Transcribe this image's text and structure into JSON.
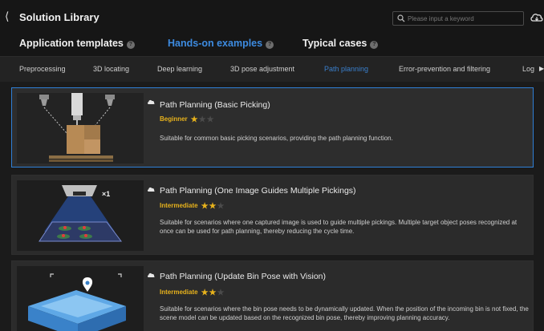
{
  "header": {
    "title": "Solution Library",
    "search_placeholder": "Please input a keyword"
  },
  "category_tabs": [
    {
      "label": "Application templates",
      "active": false
    },
    {
      "label": "Hands-on examples",
      "active": true
    },
    {
      "label": "Typical cases",
      "active": false
    }
  ],
  "sub_tabs": [
    {
      "label": "Preprocessing",
      "active": false
    },
    {
      "label": "3D locating",
      "active": false
    },
    {
      "label": "Deep learning",
      "active": false
    },
    {
      "label": "3D pose adjustment",
      "active": false
    },
    {
      "label": "Path planning",
      "active": true
    },
    {
      "label": "Error-prevention and filtering",
      "active": false
    },
    {
      "label": "Log",
      "active": false
    }
  ],
  "cards": [
    {
      "title": "Path Planning (Basic Picking)",
      "level": "Beginner",
      "stars": 1,
      "max_stars": 3,
      "description": "Suitable for common basic picking scenarios, providing the path planning function.",
      "selected": true
    },
    {
      "title": "Path Planning (One Image Guides Multiple Pickings)",
      "level": "Intermediate",
      "stars": 2,
      "max_stars": 3,
      "description": "Suitable for scenarios where one captured image is used to guide multiple pickings. Multiple target object poses recognized at once can be used for path planning, thereby reducing the cycle time.",
      "selected": false,
      "thumb_badge": "×1"
    },
    {
      "title": "Path Planning (Update Bin Pose with Vision)",
      "level": "Intermediate",
      "stars": 2,
      "max_stars": 3,
      "description": "Suitable for scenarios where the bin pose needs to be dynamically updated. When the position of the incoming bin is not fixed, the scene model can be updated based on the recognized bin pose, thereby improving planning accuracy.",
      "selected": false
    }
  ],
  "colors": {
    "accent": "#2f7fd6",
    "star": "#e7b21c",
    "background": "#1b1b1b",
    "card": "#2b2b2b"
  }
}
